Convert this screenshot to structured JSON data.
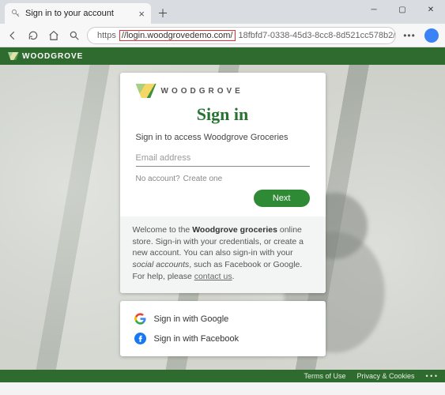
{
  "browser": {
    "tab_title": "Sign in to your account",
    "url_prefix": "https",
    "url_highlight": "//login.woodgrovedemo.com/",
    "url_suffix": "18fbfd7-0338-45d3-8cc8-8d521cc578b2/oauth2/v2...."
  },
  "header": {
    "brand_text": "WOODGROVE"
  },
  "card": {
    "brand": "WOODGROVE",
    "title": "Sign in",
    "subtitle": "Sign in to access Woodgrove Groceries",
    "email_placeholder": "Email address",
    "no_account_text": "No account?",
    "create_one": "Create one",
    "next": "Next",
    "info_pre": "Welcome to the ",
    "info_bold": "Woodgrove groceries",
    "info_mid": " online store. Sign-in with your credentials, or create a new account. You can also sign-in with your ",
    "info_italic": "social accounts",
    "info_post": ", such as Facebook or Google. For help, please ",
    "info_link": "contact us",
    "info_end": "."
  },
  "social": {
    "google": "Sign in with Google",
    "facebook": "Sign in with Facebook"
  },
  "footer": {
    "terms": "Terms of Use",
    "privacy": "Privacy & Cookies",
    "more": "• • •"
  }
}
